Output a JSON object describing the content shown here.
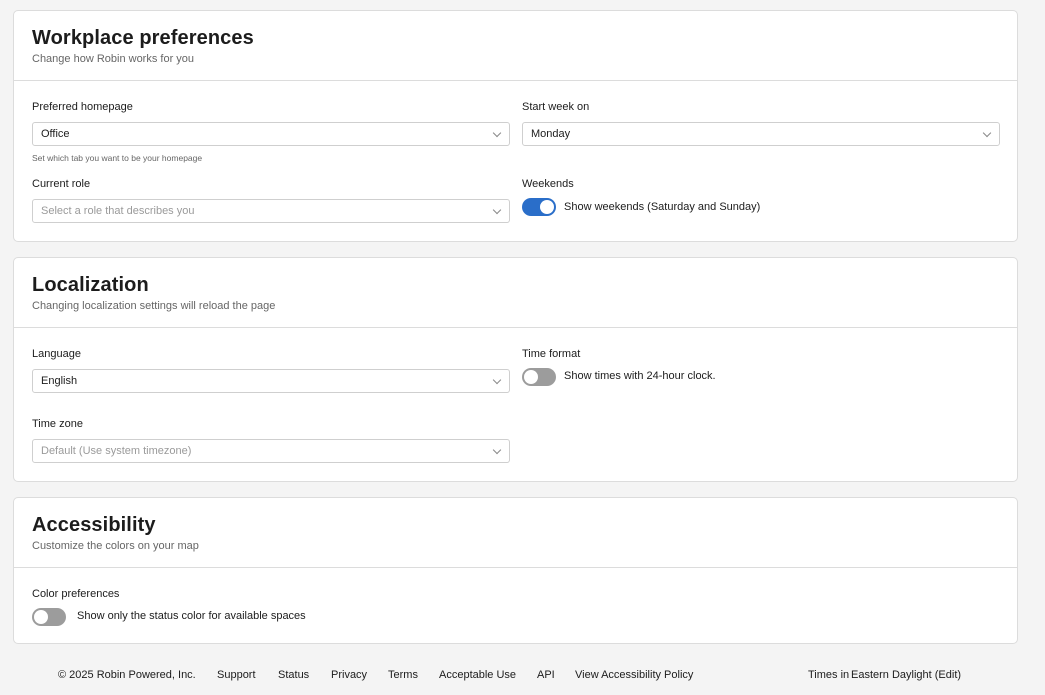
{
  "workplace": {
    "title": "Workplace preferences",
    "subtitle": "Change how Robin works for you",
    "homepage": {
      "label": "Preferred homepage",
      "value": "Office",
      "help": "Set which tab you want to be your homepage"
    },
    "start_week": {
      "label": "Start week on",
      "value": "Monday"
    },
    "role": {
      "label": "Current role",
      "placeholder": "Select a role that describes you"
    },
    "weekends": {
      "label": "Weekends",
      "toggle_text": "Show weekends (Saturday and Sunday)",
      "enabled": true
    }
  },
  "localization": {
    "title": "Localization",
    "subtitle": "Changing localization settings will reload the page",
    "language": {
      "label": "Language",
      "value": "English"
    },
    "time_format": {
      "label": "Time format",
      "toggle_text": "Show times with 24-hour clock.",
      "enabled": false
    },
    "timezone": {
      "label": "Time zone",
      "placeholder": "Default (Use system timezone)"
    }
  },
  "accessibility": {
    "title": "Accessibility",
    "subtitle": "Customize the colors on your map",
    "color_prefs": {
      "label": "Color preferences",
      "toggle_text": "Show only the status color for available spaces",
      "enabled": false
    }
  },
  "footer": {
    "copyright": "© 2025  Robin Powered, Inc.",
    "links": [
      "Support",
      "Status",
      "Privacy",
      "Terms",
      "Acceptable Use",
      "API",
      "View Accessibility Policy"
    ],
    "times_prefix": "Times in",
    "times_zone": "Eastern Daylight (Edit)"
  },
  "colors": {
    "toggle_on": "#2a6ec9",
    "toggle_off": "#9c9c9c"
  }
}
